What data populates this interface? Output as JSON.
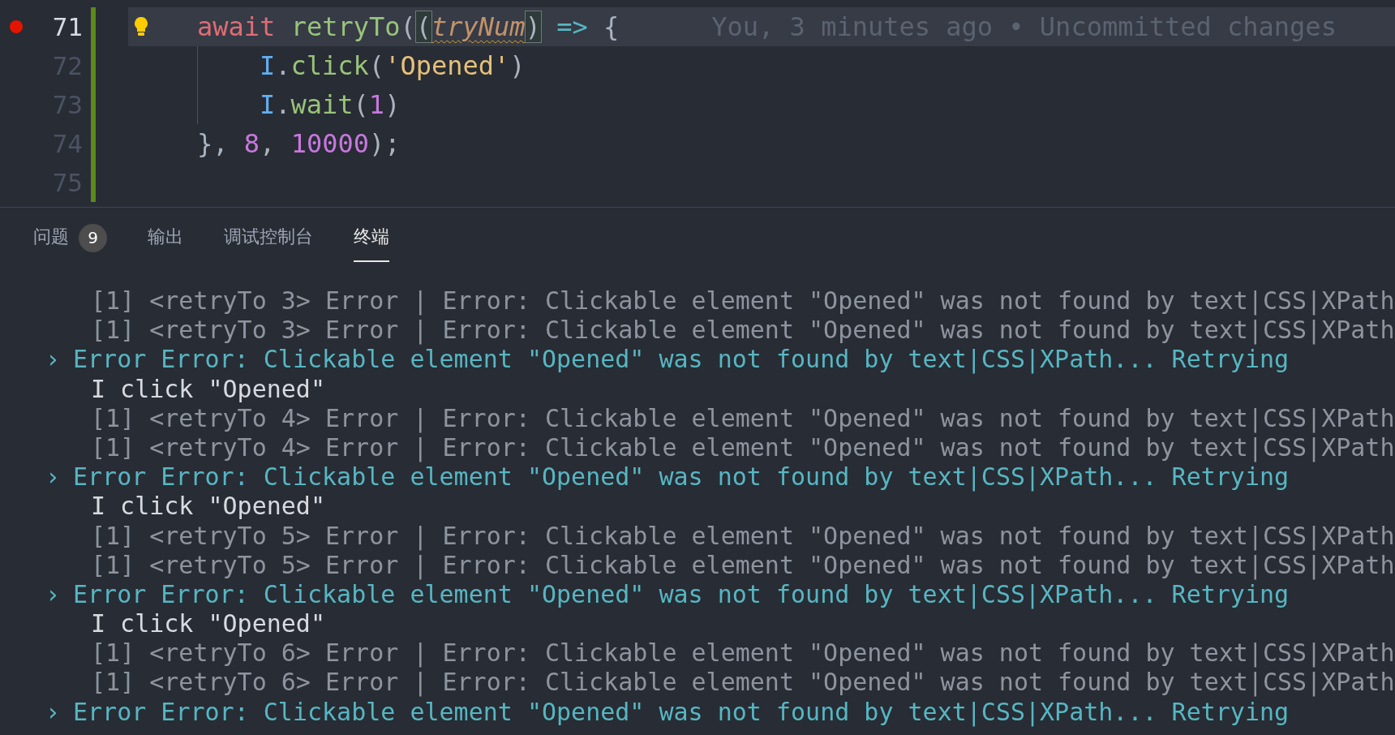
{
  "editor": {
    "lines": [
      {
        "number": "71",
        "breakpoint": true,
        "current": true,
        "lightbulb": true,
        "indented": false,
        "tokens": [
          {
            "text": "await",
            "kind": "keyword"
          },
          {
            "text": "retryTo",
            "kind": "function",
            "space": true
          },
          {
            "text": "(",
            "kind": "punct"
          },
          {
            "text": "(",
            "kind": "bracket-match"
          },
          {
            "text": "tryNum",
            "kind": "param-warning"
          },
          {
            "text": ")",
            "kind": "bracket-match"
          },
          {
            "text": "=>",
            "kind": "operator",
            "space": true
          },
          {
            "text": "{",
            "kind": "punct",
            "space": true
          }
        ],
        "blame": "You, 3 minutes ago • Uncommitted changes"
      },
      {
        "number": "72",
        "breakpoint": false,
        "current": false,
        "lightbulb": false,
        "indented": true,
        "tokens": [
          {
            "text": "I",
            "kind": "variable"
          },
          {
            "text": ".",
            "kind": "punct"
          },
          {
            "text": "click",
            "kind": "function"
          },
          {
            "text": "(",
            "kind": "punct"
          },
          {
            "text": "'Opened'",
            "kind": "string"
          },
          {
            "text": ")",
            "kind": "punct"
          }
        ]
      },
      {
        "number": "73",
        "breakpoint": false,
        "current": false,
        "lightbulb": false,
        "indented": true,
        "tokens": [
          {
            "text": "I",
            "kind": "variable"
          },
          {
            "text": ".",
            "kind": "punct"
          },
          {
            "text": "wait",
            "kind": "function"
          },
          {
            "text": "(",
            "kind": "punct"
          },
          {
            "text": "1",
            "kind": "number"
          },
          {
            "text": ")",
            "kind": "punct"
          }
        ]
      },
      {
        "number": "74",
        "breakpoint": false,
        "current": false,
        "lightbulb": false,
        "indented": false,
        "tokens": [
          {
            "text": "},",
            "kind": "punct"
          },
          {
            "text": "8",
            "kind": "number",
            "space": true
          },
          {
            "text": ",",
            "kind": "punct"
          },
          {
            "text": "10000",
            "kind": "number",
            "space": true
          },
          {
            "text": ");",
            "kind": "punct"
          }
        ]
      },
      {
        "number": "75",
        "breakpoint": false,
        "current": false,
        "lightbulb": false,
        "indented": false
      }
    ]
  },
  "panel": {
    "tabs": [
      {
        "label": "问题",
        "badge": "9",
        "selected": false
      },
      {
        "label": "输出",
        "selected": false
      },
      {
        "label": "调试控制台",
        "selected": false
      },
      {
        "label": "终端",
        "selected": true
      }
    ],
    "terminal_lines": [
      {
        "kind": "log",
        "text": "[1] <retryTo 3> Error | Error: Clickable element \"Opened\" was not found by text|CSS|XPath"
      },
      {
        "kind": "log",
        "text": "[1] <retryTo 3> Error | Error: Clickable element \"Opened\" was not found by text|CSS|XPath"
      },
      {
        "kind": "error",
        "marker": "›",
        "text": "Error Error: Clickable element \"Opened\" was not found by text|CSS|XPath... Retrying"
      },
      {
        "kind": "step",
        "text": "I click \"Opened\""
      },
      {
        "kind": "log",
        "text": "[1] <retryTo 4> Error | Error: Clickable element \"Opened\" was not found by text|CSS|XPath"
      },
      {
        "kind": "log",
        "text": "[1] <retryTo 4> Error | Error: Clickable element \"Opened\" was not found by text|CSS|XPath"
      },
      {
        "kind": "error",
        "marker": "›",
        "text": "Error Error: Clickable element \"Opened\" was not found by text|CSS|XPath... Retrying"
      },
      {
        "kind": "step",
        "text": "I click \"Opened\""
      },
      {
        "kind": "log",
        "text": "[1] <retryTo 5> Error | Error: Clickable element \"Opened\" was not found by text|CSS|XPath"
      },
      {
        "kind": "log",
        "text": "[1] <retryTo 5> Error | Error: Clickable element \"Opened\" was not found by text|CSS|XPath"
      },
      {
        "kind": "error",
        "marker": "›",
        "text": "Error Error: Clickable element \"Opened\" was not found by text|CSS|XPath... Retrying"
      },
      {
        "kind": "step",
        "text": "I click \"Opened\""
      },
      {
        "kind": "log",
        "text": "[1] <retryTo 6> Error | Error: Clickable element \"Opened\" was not found by text|CSS|XPath"
      },
      {
        "kind": "log",
        "text": "[1] <retryTo 6> Error | Error: Clickable element \"Opened\" was not found by text|CSS|XPath"
      },
      {
        "kind": "error",
        "marker": "›",
        "text": "Error Error: Clickable element \"Opened\" was not found by text|CSS|XPath... Retrying"
      }
    ]
  }
}
